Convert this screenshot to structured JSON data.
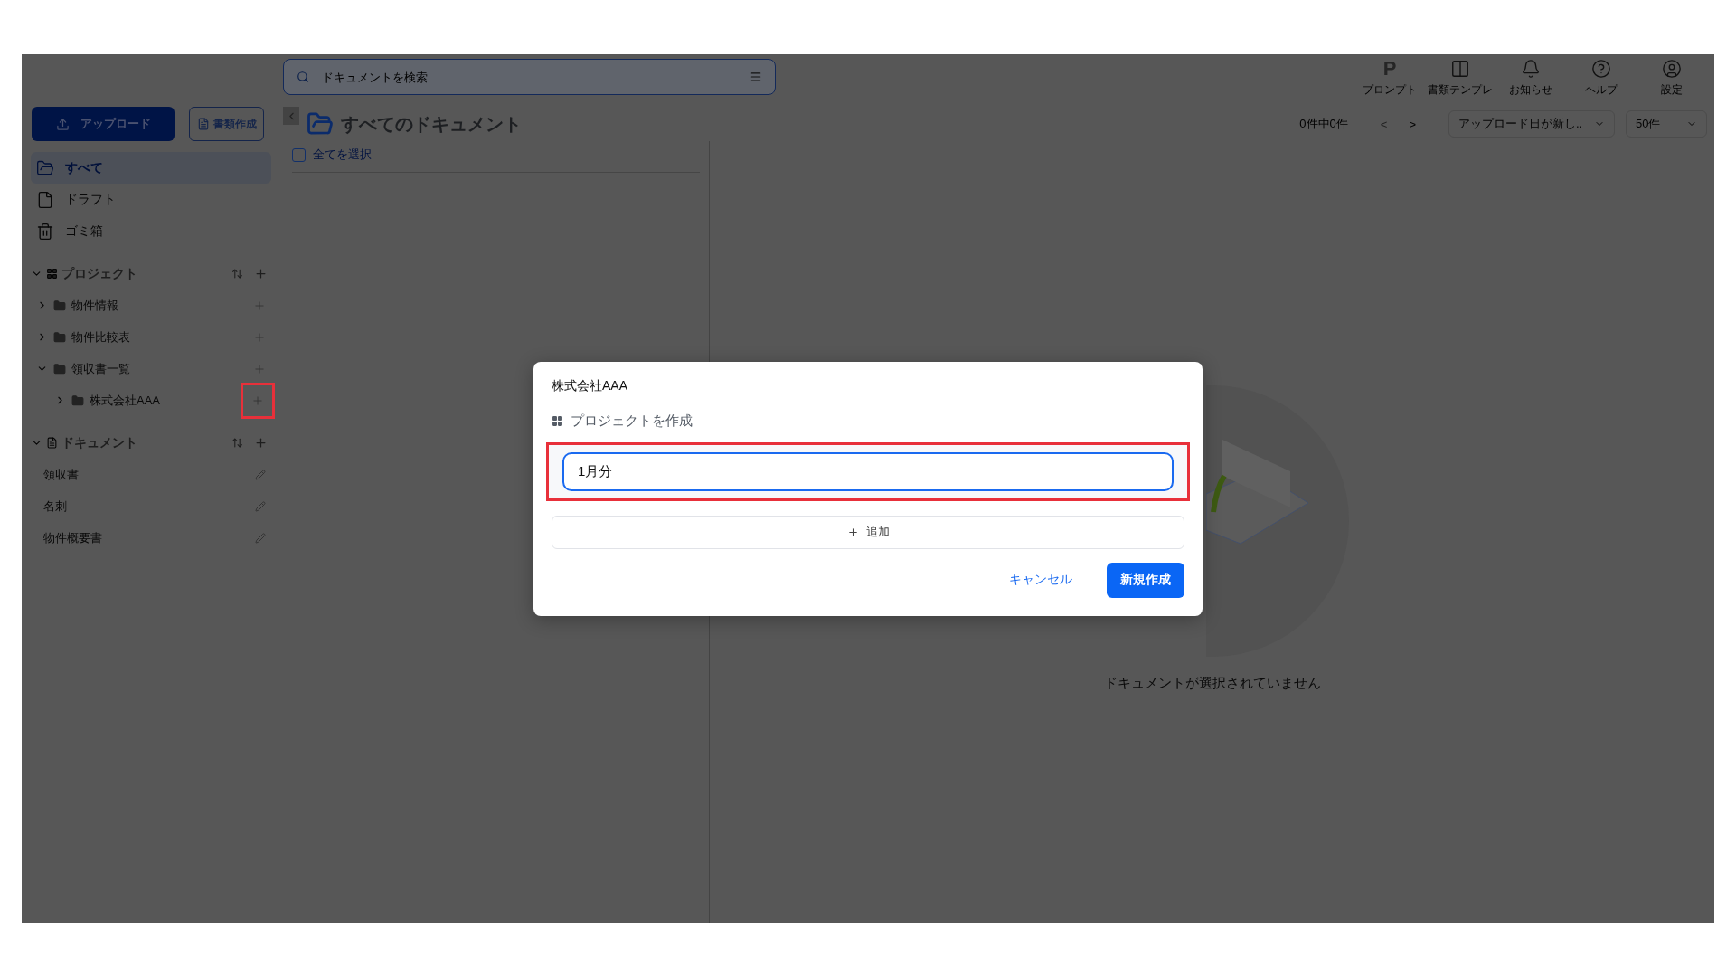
{
  "search": {
    "placeholder": "ドキュメントを検索"
  },
  "sidebar": {
    "upload_button": "アップロード",
    "create_button": "書類作成",
    "nav": [
      {
        "kind": "all",
        "label": "すべて",
        "selected": true
      },
      {
        "kind": "draft",
        "label": "ドラフト",
        "selected": false
      },
      {
        "kind": "trash",
        "label": "ゴミ箱",
        "selected": false
      }
    ],
    "projects": {
      "title": "プロジェクト",
      "expanded": true,
      "items": [
        {
          "label": "物件情報",
          "expanded": false,
          "highlighted": false
        },
        {
          "label": "物件比較表",
          "expanded": false,
          "highlighted": false
        },
        {
          "label": "領収書一覧",
          "expanded": true,
          "highlighted": false,
          "children": [
            {
              "label": "株式会社AAA",
              "expanded": false,
              "highlighted": true
            }
          ]
        }
      ]
    },
    "documents": {
      "title": "ドキュメント",
      "expanded": true,
      "items": [
        {
          "label": "領収書"
        },
        {
          "label": "名刺"
        },
        {
          "label": "物件概要書"
        }
      ]
    }
  },
  "toolbar": [
    {
      "kind": "prompt",
      "glyph": "P",
      "label": "プロンプト"
    },
    {
      "kind": "template",
      "label": "書類テンプレ"
    },
    {
      "kind": "notice",
      "label": "お知らせ"
    },
    {
      "kind": "help",
      "label": "ヘルプ"
    },
    {
      "kind": "settings",
      "label": "設定"
    }
  ],
  "main": {
    "title": "すべてのドキュメント",
    "select_all": {
      "label": "全てを選択",
      "checked": false
    },
    "count": "0件中0件",
    "prev": "<",
    "next": ">",
    "sort": "アップロード日が新し..",
    "page_size": "50件",
    "empty": "ドキュメントが選択されていません"
  },
  "modal": {
    "heading": "株式会社AAA",
    "subtitle": "プロジェクトを作成",
    "fields": [
      {
        "value": "1月分",
        "focused": true,
        "highlighted": true
      }
    ],
    "add_button": "追加",
    "cancel": "キャンセル",
    "submit": "新規作成"
  }
}
